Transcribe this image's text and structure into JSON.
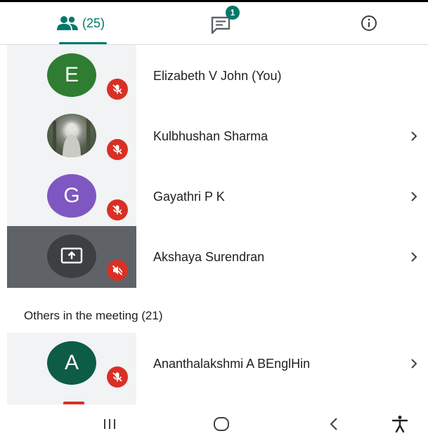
{
  "tabs": {
    "people_count": "(25)",
    "chat_badge": "1"
  },
  "participants": [
    {
      "name": "Elizabeth V John (You)",
      "avatar_letter": "E",
      "avatar_color": "#2e7d32"
    },
    {
      "name": "Kulbhushan Sharma",
      "avatar_letter": "",
      "avatar_color": "#6b7065"
    },
    {
      "name": "Gayathri P K",
      "avatar_letter": "G",
      "avatar_color": "#7e57c2"
    },
    {
      "name": "Akshaya Surendran",
      "avatar_letter": "",
      "avatar_color": "#3c4043"
    }
  ],
  "others": {
    "title": "Others in the meeting (21)",
    "items": [
      {
        "name": "Ananthalakshmi A BEnglHin",
        "avatar_letter": "A",
        "avatar_color": "#0d5c46"
      }
    ]
  },
  "colors": {
    "accent": "#00796b",
    "muted_red": "#d93025",
    "tile_bg": "#f1f3f4",
    "presenting_bg": "#5f6368"
  },
  "icons": {
    "people_tab": "people-icon",
    "chat_tab": "chat-icon",
    "info_tab": "info-icon",
    "muted": "mic-off-icon",
    "audio_off": "volume-off-icon",
    "presenting": "present-screen-icon",
    "open": "chevron-right-icon",
    "nav_recent": "recent-apps-icon",
    "nav_home": "home-icon",
    "nav_back": "back-icon",
    "nav_accessibility": "accessibility-icon"
  }
}
